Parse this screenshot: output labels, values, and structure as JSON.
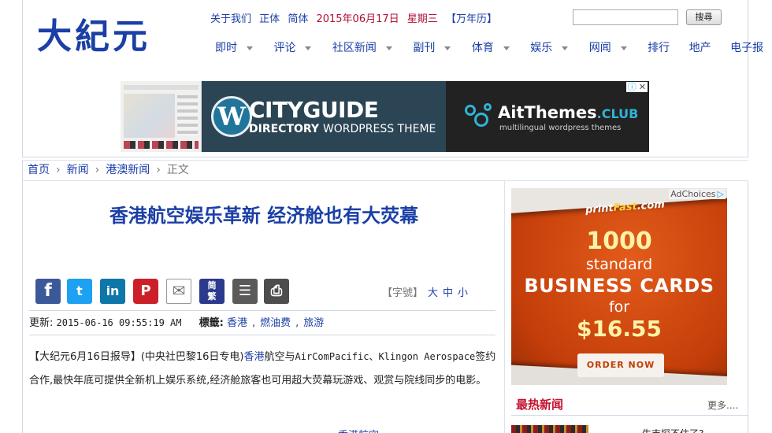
{
  "header": {
    "logo": "大紀元",
    "top_links": [
      "关于我们",
      "正体",
      "简体"
    ],
    "date": "2015年06月17日",
    "weekday": "星期三",
    "calendar_link": "【万年历】",
    "search_placeholder": "",
    "search_button": "搜尋",
    "nav": [
      {
        "label": "即时",
        "dropdown": true
      },
      {
        "label": "评论",
        "dropdown": true
      },
      {
        "label": "社区新闻",
        "dropdown": true
      },
      {
        "label": "副刊",
        "dropdown": true
      },
      {
        "label": "体育",
        "dropdown": true
      },
      {
        "label": "娱乐",
        "dropdown": true
      },
      {
        "label": "网闻",
        "dropdown": true
      },
      {
        "label": "排行",
        "dropdown": false
      },
      {
        "label": "地产",
        "dropdown": false
      },
      {
        "label": "电子报",
        "dropdown": false
      }
    ]
  },
  "banner_ad": {
    "left_title": "CITYGUIDE",
    "left_sub_bold": "DIRECTORY",
    "left_sub_thin": "WORDPRESS THEME",
    "right_title": "AitThemes",
    "right_title_suffix": ".CLUB",
    "right_sub": "multilingual wordpress themes",
    "adchoices_icon": "info-icon"
  },
  "breadcrumb": {
    "items": [
      "首页",
      "新闻",
      "港澳新闻"
    ],
    "current": "正文",
    "separator": "›"
  },
  "article": {
    "headline": "香港航空娱乐革新 经济舱也有大荧幕",
    "share_icons": [
      "facebook-icon",
      "twitter-icon",
      "linkedin-icon",
      "pinterest-icon",
      "email-icon",
      "simplified-traditional-icon",
      "notes-icon",
      "print-icon"
    ],
    "jianfan_label_top": "简",
    "jianfan_label_bottom": "繁",
    "font_size_label": "【字號】",
    "font_sizes": [
      "大",
      "中",
      "小"
    ],
    "updated_label": "更新:",
    "updated_value": "2015-06-16 09:55:19 AM",
    "tags_label": "標籤:",
    "tags": [
      "香港",
      "燃油费",
      "旅游"
    ],
    "tag_separator": ",",
    "body_prefix": "【大纪元6月16日报导】(中央社巴黎16日专电)",
    "body_link": "香港",
    "body_after_link": "航空与",
    "body_latin": "AirComPacific、Klingon Aerospace",
    "body_rest": "签约合作,最快年底可提供全新机上娱乐系统,经济舱旅客也可用超大荧幕玩游戏、观赏与院线同步的电影。",
    "body_more": "香港航空..."
  },
  "sidebar": {
    "ad": {
      "brand_print": "print",
      "brand_fast": "Fast",
      "brand_domain": ".com",
      "adchoices": "AdChoices",
      "number": "1000",
      "standard": "standard",
      "product": "BUSINESS CARDS",
      "for": "for",
      "price": "$16.55",
      "cta": "ORDER NOW"
    },
    "hot_news_title": "最热新闻",
    "hot_news_more": "更多....",
    "hot_news_first_item": "生吉探不住了?",
    "colors": {
      "accent": "#1b3fa6",
      "hot": "#c4122f",
      "ad_orange": "#d9531e"
    }
  }
}
